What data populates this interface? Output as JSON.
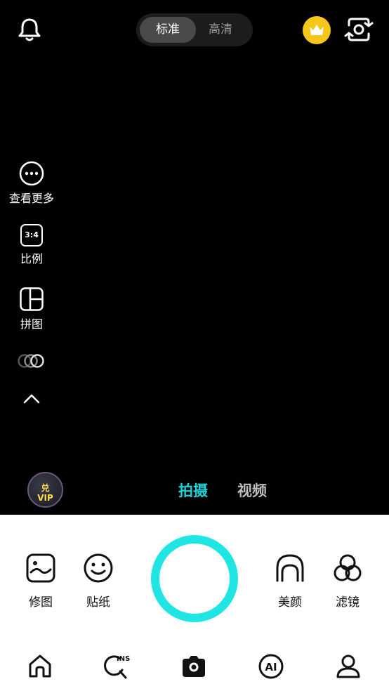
{
  "top_bar": {
    "quality_options": [
      "标准",
      "高清"
    ],
    "selected_quality": "标准",
    "crown_color": "#f6c619"
  },
  "side_tools": {
    "more_label": "查看更多",
    "ratio_value": "3:4",
    "ratio_label": "比例",
    "collage_label": "拼图"
  },
  "mode_switch": {
    "vip_text_line1": "兑",
    "vip_text_line2": "VIP",
    "modes": [
      "拍摄",
      "视频"
    ],
    "active_mode": "拍摄",
    "accent_color": "#1fd1d9"
  },
  "bottom_tools": {
    "edit_label": "修图",
    "sticker_label": "贴纸",
    "beauty_label": "美颜",
    "filter_label": "滤镜"
  },
  "bottom_nav": {
    "icons": [
      "home-icon",
      "ins-search-icon",
      "camera-icon",
      "ai-icon",
      "profile-icon"
    ],
    "ins_text": "INS",
    "ai_text": "AI"
  }
}
